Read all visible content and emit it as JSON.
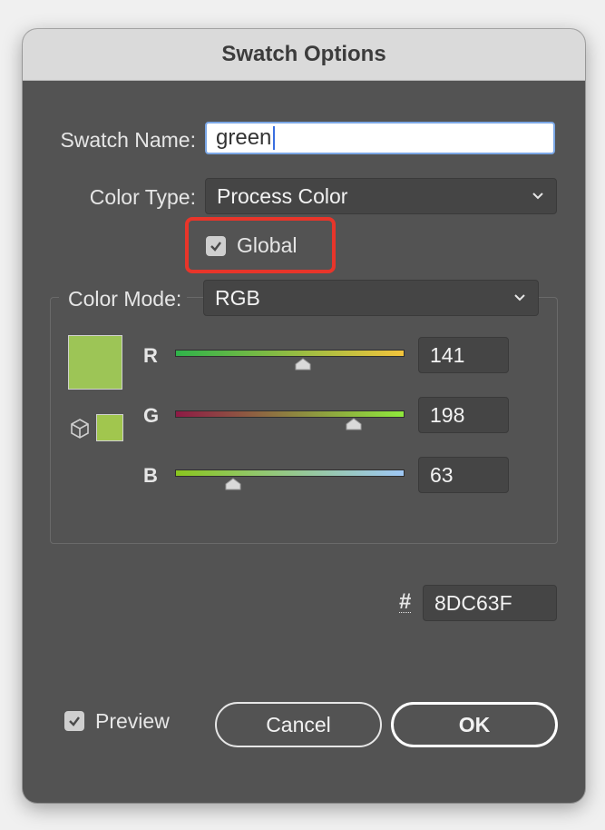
{
  "dialog": {
    "title": "Swatch Options"
  },
  "swatch_name": {
    "label": "Swatch Name:",
    "value": "green"
  },
  "color_type": {
    "label": "Color Type:",
    "value": "Process Color"
  },
  "global": {
    "label": "Global",
    "checked": true
  },
  "color_mode": {
    "label": "Color Mode:",
    "value": "RGB"
  },
  "channels": [
    {
      "label": "R",
      "value": "141"
    },
    {
      "label": "G",
      "value": "198"
    },
    {
      "label": "B",
      "value": "63"
    }
  ],
  "hex": {
    "symbol": "#",
    "value": "8DC63F"
  },
  "preview": {
    "label": "Preview",
    "checked": true
  },
  "buttons": {
    "cancel": "Cancel",
    "ok": "OK"
  },
  "colors": {
    "swatch": "#9DC556",
    "swatch_small": "#A1C64E",
    "dialog_bg": "#535353",
    "highlight": "#E8352A"
  }
}
